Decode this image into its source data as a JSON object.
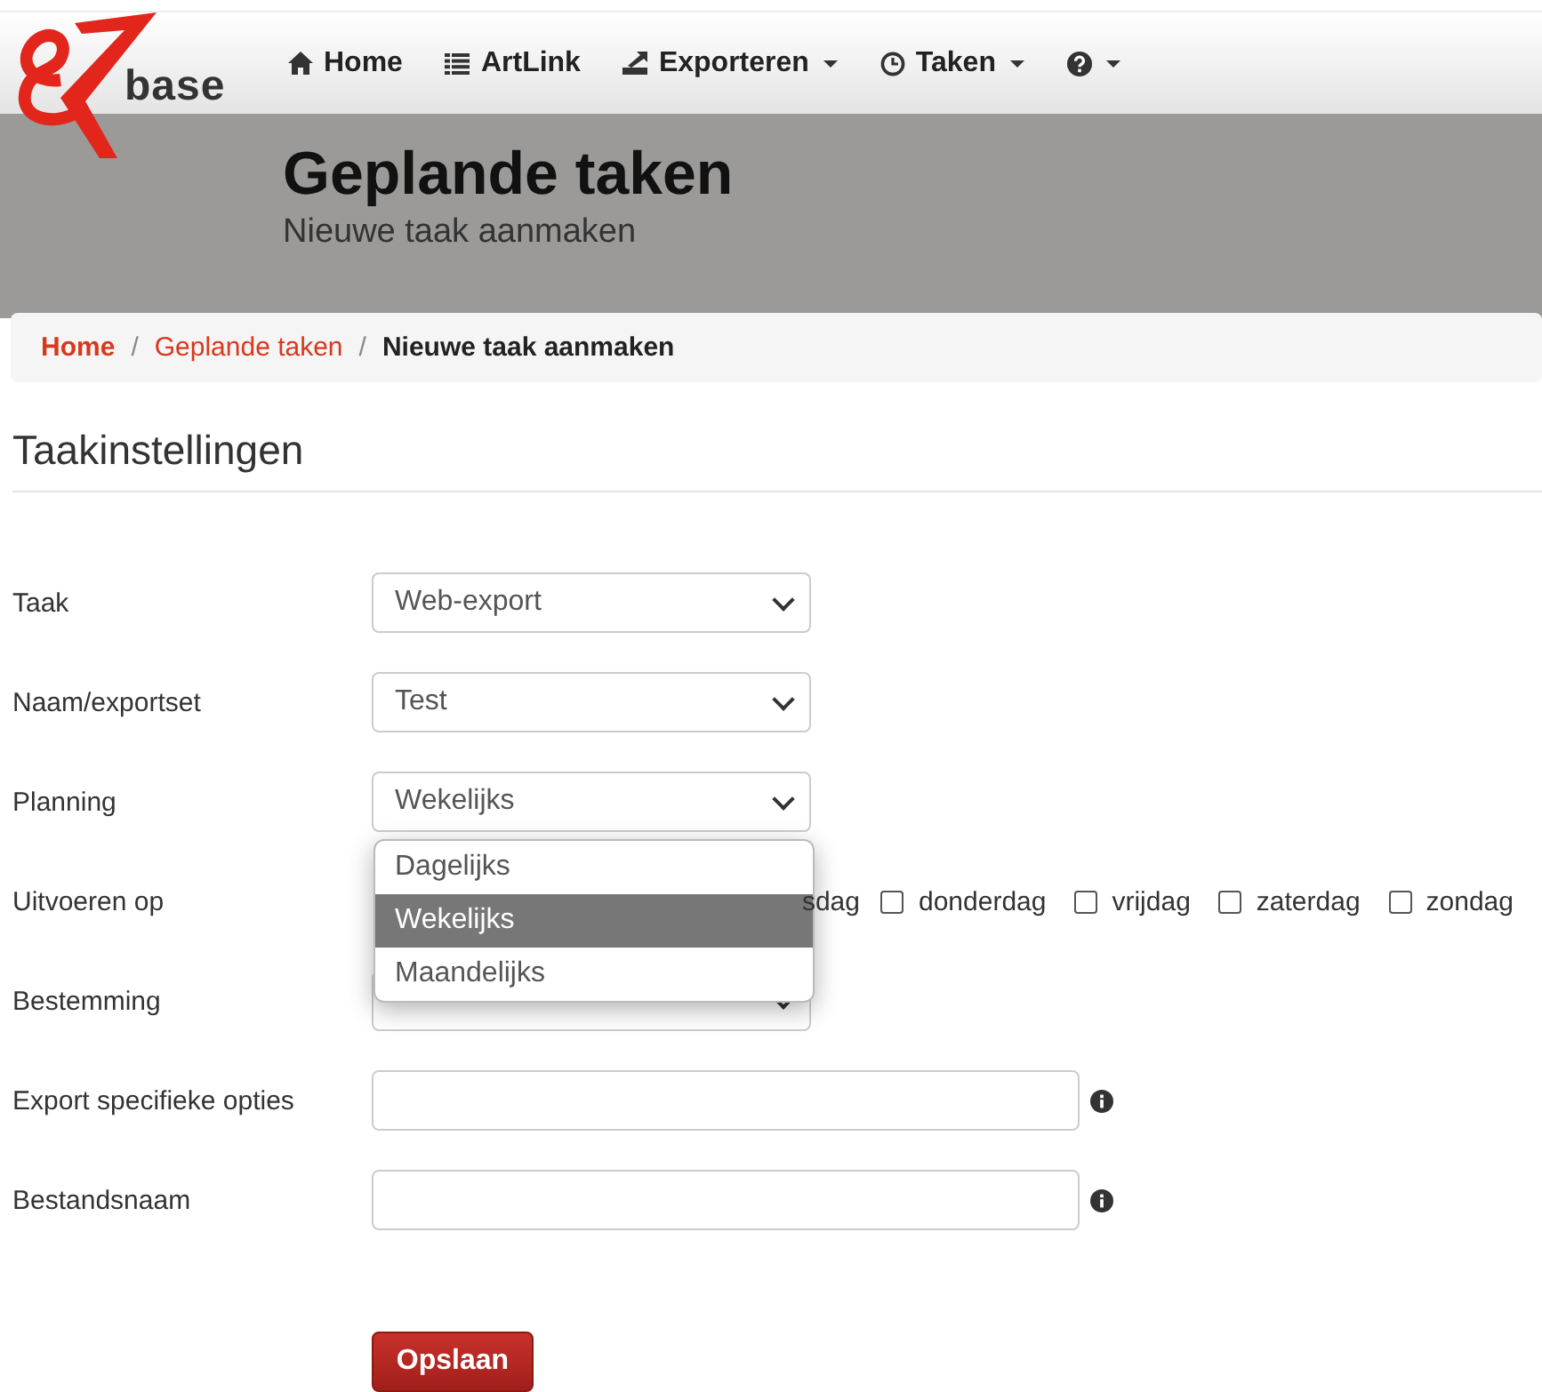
{
  "logo": {
    "text": "base"
  },
  "nav": [
    {
      "label": "Home",
      "caret": false
    },
    {
      "label": "ArtLink",
      "caret": false
    },
    {
      "label": "Exporteren",
      "caret": true
    },
    {
      "label": "Taken",
      "caret": true
    },
    {
      "caret": true
    }
  ],
  "header": {
    "title": "Geplande taken",
    "subtitle": "Nieuwe taak aanmaken"
  },
  "breadcrumb": [
    {
      "label": "Home",
      "kind": "link"
    },
    {
      "label": "Geplande taken",
      "kind": "link"
    },
    {
      "label": "Nieuwe taak aanmaken",
      "kind": "current"
    }
  ],
  "breadcrumb_separator": "/",
  "section_title": "Taakinstellingen",
  "form": [
    {
      "label": "Taak",
      "kind": "select",
      "value": "Web-export"
    },
    {
      "label": "Naam/exportset",
      "kind": "select",
      "value": "Test"
    },
    {
      "label": "Planning",
      "kind": "select",
      "value": "Wekelijks",
      "open": true,
      "options": [
        {
          "label": "Dagelijks",
          "selected": false
        },
        {
          "label": "Wekelijks",
          "selected": true
        },
        {
          "label": "Maandelijks",
          "selected": false
        }
      ]
    },
    {
      "label": "Uitvoeren op",
      "kind": "days",
      "days": [
        {
          "kind": "fragment",
          "label": "sdag"
        },
        {
          "kind": "checkbox",
          "label": "donderdag",
          "checked": false
        },
        {
          "kind": "checkbox",
          "label": "vrijdag",
          "checked": false
        },
        {
          "kind": "checkbox",
          "label": "zaterdag",
          "checked": false
        },
        {
          "kind": "checkbox",
          "label": "zondag",
          "checked": false
        }
      ]
    },
    {
      "label": "Bestemming",
      "kind": "select"
    },
    {
      "label": "Export specifieke opties",
      "kind": "text",
      "info": true
    },
    {
      "label": "Bestandsnaam",
      "kind": "text",
      "info": true
    }
  ],
  "save_button": "Opslaan"
}
